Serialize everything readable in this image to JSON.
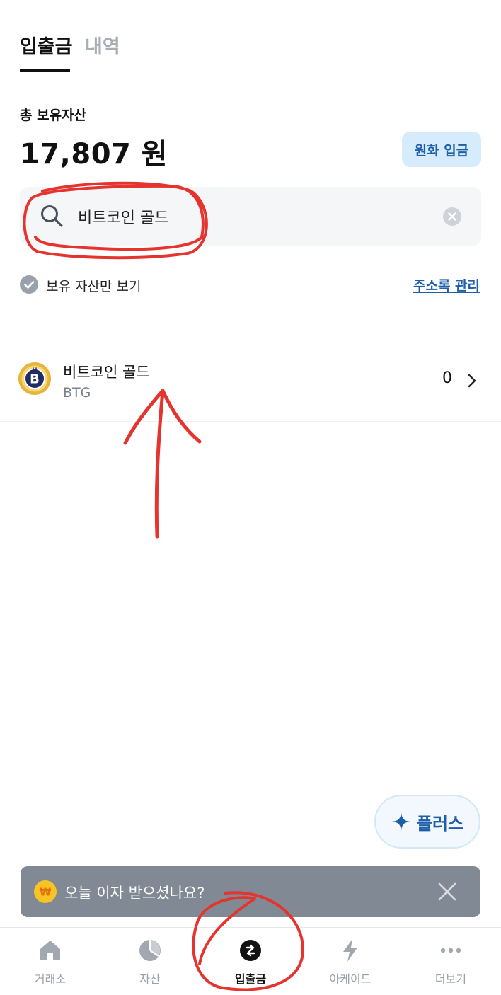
{
  "header": {
    "tabs": [
      {
        "label": "입출금",
        "active": true
      },
      {
        "label": "내역",
        "active": false
      }
    ]
  },
  "summary": {
    "label": "총 보유자산",
    "value": "17,807 원",
    "deposit_button": "원화 입금"
  },
  "search": {
    "value": "비트코인 골드",
    "icon": "search-icon",
    "clear_icon": "clear-icon"
  },
  "filter": {
    "label": "보유 자산만 보기",
    "checked": false,
    "address_link": "주소록 관리"
  },
  "results": [
    {
      "name": "비트코인 골드",
      "symbol": "BTG",
      "amount": "0"
    }
  ],
  "plus_button": {
    "label": "플러스",
    "icon": "sparkle-icon"
  },
  "banner": {
    "text": "오늘 이자 받으셨나요?",
    "icon": "won-coin-icon"
  },
  "nav": {
    "items": [
      {
        "label": "거래소",
        "icon": "home-icon",
        "active": false
      },
      {
        "label": "자산",
        "icon": "pie-chart-icon",
        "active": false
      },
      {
        "label": "입출금",
        "icon": "transfer-icon",
        "active": true
      },
      {
        "label": "아케이드",
        "icon": "lightning-icon",
        "active": false
      },
      {
        "label": "더보기",
        "icon": "more-icon",
        "active": false
      }
    ]
  },
  "colors": {
    "accent": "#1e5fa8",
    "annotation": "#e5332e",
    "banner_bg": "#818994"
  }
}
